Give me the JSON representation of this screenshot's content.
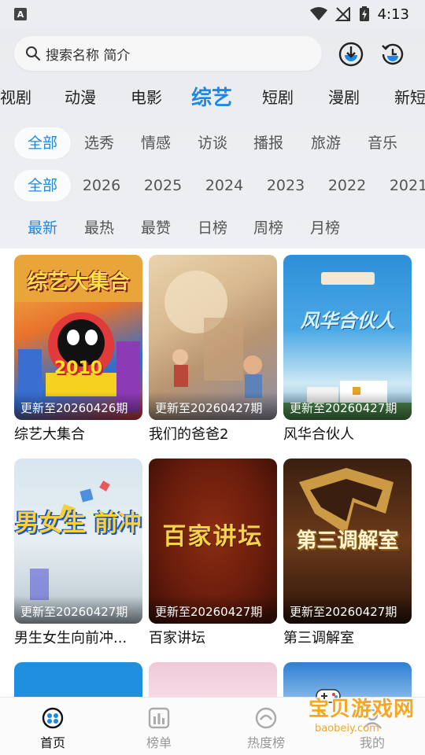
{
  "status_bar": {
    "time": "4:13",
    "badge": "A"
  },
  "search": {
    "placeholder": "搜索名称 简介"
  },
  "main_tabs": [
    "视剧",
    "动漫",
    "电影",
    "综艺",
    "短剧",
    "漫剧",
    "新短"
  ],
  "main_tab_active": "综艺",
  "genre_chips": [
    "全部",
    "选秀",
    "情感",
    "访谈",
    "播报",
    "旅游",
    "音乐"
  ],
  "year_chips": [
    "全部",
    "2026",
    "2025",
    "2024",
    "2023",
    "2022",
    "2021"
  ],
  "sort_chips": [
    "最新",
    "最热",
    "最赞",
    "日榜",
    "周榜",
    "月榜"
  ],
  "cards": [
    {
      "title": "综艺大集合",
      "update": "更新至20260426期",
      "poster_text": "综艺大集合",
      "poster_sub": "2010"
    },
    {
      "title": "我们的爸爸2",
      "update": "更新至20260427期",
      "poster_text": ""
    },
    {
      "title": "风华合伙人",
      "update": "更新至20260427期",
      "poster_text": "风华合伙人"
    },
    {
      "title": "男生女生向前冲...",
      "update": "更新至20260427期",
      "poster_text": "男女生 前冲"
    },
    {
      "title": "百家讲坛",
      "update": "更新至20260427期",
      "poster_text": "百家讲坛"
    },
    {
      "title": "第三调解室",
      "update": "更新至20260427期",
      "poster_text": "第三调解室"
    }
  ],
  "bottom_nav": [
    {
      "label": "首页",
      "icon": "home-icon",
      "active": true
    },
    {
      "label": "榜单",
      "icon": "chart-icon",
      "active": false
    },
    {
      "label": "热度榜",
      "icon": "hot-icon",
      "active": false
    },
    {
      "label": "我的",
      "icon": "profile-icon",
      "active": false
    }
  ],
  "watermark": {
    "text": "宝贝游戏网",
    "url": "baobeiy.com"
  },
  "colors": {
    "accent": "#1e88e5",
    "background": "#f1f2f4"
  }
}
